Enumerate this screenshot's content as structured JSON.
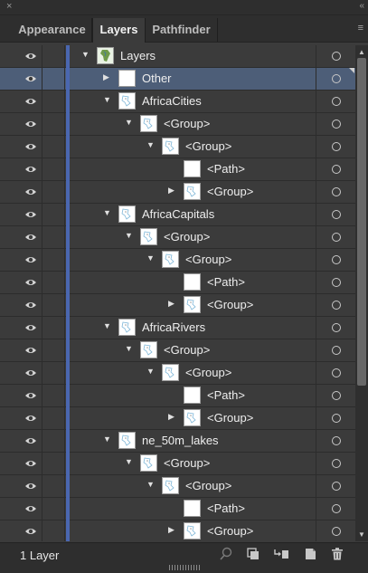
{
  "window": {
    "close_glyph": "×",
    "collapse_glyph": "«"
  },
  "tabs": [
    {
      "label": "Appearance",
      "active": false
    },
    {
      "label": "Layers",
      "active": true
    },
    {
      "label": "Pathfinder",
      "active": false
    }
  ],
  "panel_menu_glyph": "≡",
  "rows": [
    {
      "name": "Layers",
      "level": 0,
      "expanded": true,
      "has_toggle": true,
      "thumb": "map",
      "selected": false
    },
    {
      "name": "Other",
      "level": 1,
      "expanded": false,
      "has_toggle": true,
      "thumb": "blank",
      "selected": true
    },
    {
      "name": "AfricaCities",
      "level": 1,
      "expanded": true,
      "has_toggle": true,
      "thumb": "art",
      "selected": false
    },
    {
      "name": "<Group>",
      "level": 2,
      "expanded": true,
      "has_toggle": true,
      "thumb": "art",
      "selected": false
    },
    {
      "name": "<Group>",
      "level": 3,
      "expanded": true,
      "has_toggle": true,
      "thumb": "art",
      "selected": false
    },
    {
      "name": "<Path>",
      "level": 4,
      "expanded": false,
      "has_toggle": false,
      "thumb": "blank",
      "selected": false
    },
    {
      "name": "<Group>",
      "level": 4,
      "expanded": false,
      "has_toggle": true,
      "thumb": "art",
      "selected": false
    },
    {
      "name": "AfricaCapitals",
      "level": 1,
      "expanded": true,
      "has_toggle": true,
      "thumb": "art",
      "selected": false
    },
    {
      "name": "<Group>",
      "level": 2,
      "expanded": true,
      "has_toggle": true,
      "thumb": "art",
      "selected": false
    },
    {
      "name": "<Group>",
      "level": 3,
      "expanded": true,
      "has_toggle": true,
      "thumb": "art",
      "selected": false
    },
    {
      "name": "<Path>",
      "level": 4,
      "expanded": false,
      "has_toggle": false,
      "thumb": "blank",
      "selected": false
    },
    {
      "name": "<Group>",
      "level": 4,
      "expanded": false,
      "has_toggle": true,
      "thumb": "art",
      "selected": false
    },
    {
      "name": "AfricaRivers",
      "level": 1,
      "expanded": true,
      "has_toggle": true,
      "thumb": "art",
      "selected": false
    },
    {
      "name": "<Group>",
      "level": 2,
      "expanded": true,
      "has_toggle": true,
      "thumb": "art",
      "selected": false
    },
    {
      "name": "<Group>",
      "level": 3,
      "expanded": true,
      "has_toggle": true,
      "thumb": "art",
      "selected": false
    },
    {
      "name": "<Path>",
      "level": 4,
      "expanded": false,
      "has_toggle": false,
      "thumb": "blank",
      "selected": false
    },
    {
      "name": "<Group>",
      "level": 4,
      "expanded": false,
      "has_toggle": true,
      "thumb": "art",
      "selected": false
    },
    {
      "name": "ne_50m_lakes",
      "level": 1,
      "expanded": true,
      "has_toggle": true,
      "thumb": "art",
      "selected": false
    },
    {
      "name": "<Group>",
      "level": 2,
      "expanded": true,
      "has_toggle": true,
      "thumb": "art",
      "selected": false
    },
    {
      "name": "<Group>",
      "level": 3,
      "expanded": true,
      "has_toggle": true,
      "thumb": "art",
      "selected": false
    },
    {
      "name": "<Path>",
      "level": 4,
      "expanded": false,
      "has_toggle": false,
      "thumb": "blank",
      "selected": false
    },
    {
      "name": "<Group>",
      "level": 4,
      "expanded": false,
      "has_toggle": true,
      "thumb": "art",
      "selected": false
    }
  ],
  "footer": {
    "layer_count": "1 Layer",
    "icons": [
      "locate-object-icon",
      "make-clipping-mask-icon",
      "create-sublayer-icon",
      "create-new-layer-icon",
      "delete-selection-icon"
    ]
  },
  "colors": {
    "layer_color": "#4a67b0",
    "selected_row": "#4d5e78"
  }
}
